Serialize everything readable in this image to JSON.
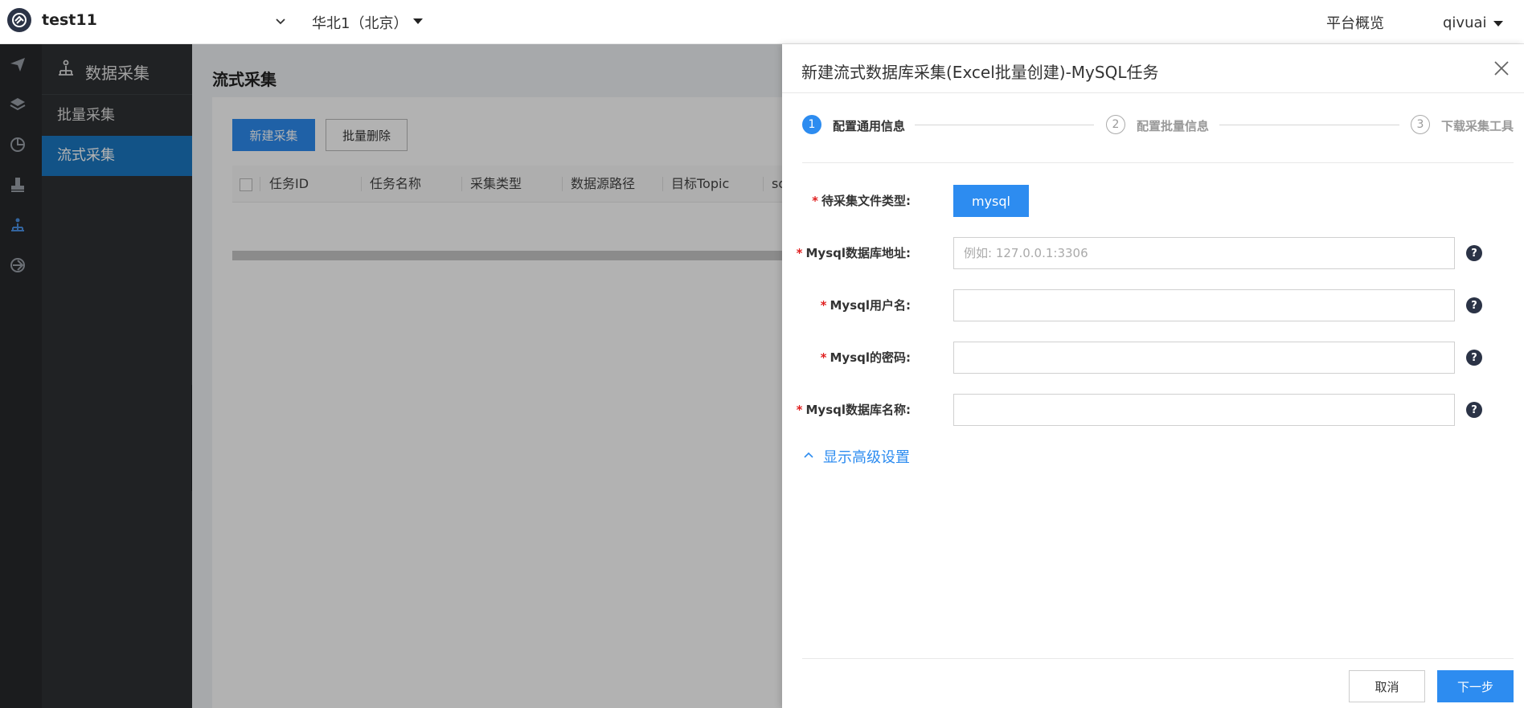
{
  "header": {
    "project_name": "test11",
    "region": "华北1（北京）",
    "nav_overview": "平台概览",
    "user_name": "qivuai"
  },
  "sidebar": {
    "title": "数据采集",
    "items": [
      {
        "label": "批量采集",
        "active": false
      },
      {
        "label": "流式采集",
        "active": true
      }
    ]
  },
  "rail": {
    "icons": [
      "send-icon",
      "layers-icon",
      "pie-chart-icon",
      "stamp-icon",
      "collect-icon",
      "share-icon"
    ]
  },
  "main": {
    "page_title": "流式采集",
    "buttons": {
      "new": "新建采集",
      "batch_delete": "批量删除"
    },
    "table": {
      "columns": [
        "任务ID",
        "任务名称",
        "采集类型",
        "数据源路径",
        "目标Topic",
        "so"
      ]
    },
    "collapse_label": "«"
  },
  "drawer": {
    "title": "新建流式数据库采集(Excel批量创建)-MySQL任务",
    "steps": [
      {
        "number": "1",
        "label": "配置通用信息",
        "active": true
      },
      {
        "number": "2",
        "label": "配置批量信息",
        "active": false
      },
      {
        "number": "3",
        "label": "下载采集工具",
        "active": false
      }
    ],
    "form": {
      "file_type_label": "待采集文件类型:",
      "file_type_value": "mysql",
      "address_label": "Mysql数据库地址:",
      "address_placeholder": "例如: 127.0.0.1:3306",
      "username_label": "Mysql用户名:",
      "password_label": "Mysql的密码:",
      "dbname_label": "Mysql数据库名称:",
      "required_mark": "*",
      "help_glyph": "?"
    },
    "advanced_label": "显示高级设置",
    "footer": {
      "cancel": "取消",
      "next": "下一步"
    }
  },
  "colors": {
    "primary": "#2d8cf0",
    "sidebar_active": "#1a78c2",
    "rail_bg": "#27292c",
    "sidebar_bg": "#2f3134",
    "required": "#e02020"
  }
}
